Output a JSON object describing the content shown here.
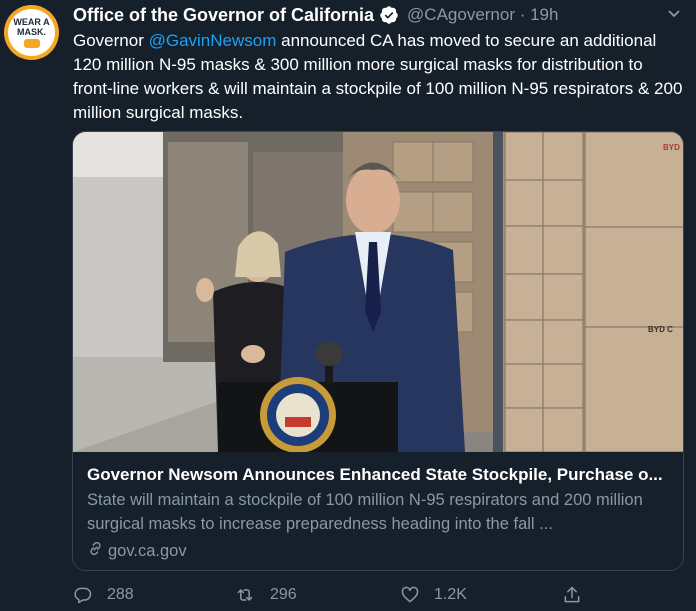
{
  "avatar": {
    "line1": "WEAR A",
    "line2": "MASK."
  },
  "tweet": {
    "author_name": "Office of the Governor of California",
    "handle_time": "@CAgovernor · 19h",
    "text_prefix": "Governor ",
    "mention": "@GavinNewsom",
    "text_suffix": " announced CA has moved to secure an additional 120 million N-95 masks & 300 million more surgical masks for distribution to front-line workers & will maintain a stockpile of 100 million N-95 respirators & 200 million surgical masks."
  },
  "card": {
    "title": "Governor Newsom Announces Enhanced State Stockpile, Purchase o...",
    "description": "State will maintain a stockpile of 100 million N-95 respirators and 200 million surgical masks to increase preparedness heading into the fall ...",
    "domain": "gov.ca.gov",
    "box_label_1": "BYD",
    "box_label_2": "BYD C",
    "seal_text": "THE GREAT SEAL OF THE STATE OF CALIFORNIA"
  },
  "actions": {
    "reply_count": "288",
    "retweet_count": "296",
    "like_count": "1.2K"
  },
  "icons": [
    "verified-icon",
    "more-icon",
    "reply-icon",
    "retweet-icon",
    "like-icon",
    "share-icon",
    "link-icon"
  ],
  "colors": {
    "background": "#15202b",
    "accent": "#1da1f2",
    "muted": "#8899a6",
    "border": "#38444d"
  }
}
